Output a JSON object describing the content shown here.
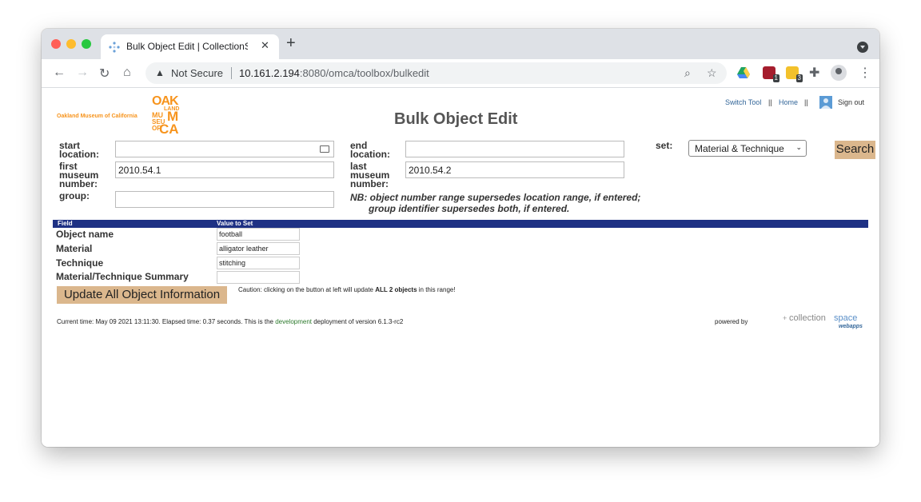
{
  "browser": {
    "tab_title": "Bulk Object Edit | CollectionSp",
    "security_label": "Not Secure",
    "url_host": "10.161.2.194",
    "url_rest": ":8080/omca/toolbox/bulkedit",
    "extension_badges": [
      "1",
      "3"
    ]
  },
  "header": {
    "org_name": "Oakland Museum of California",
    "logo_lines": [
      "OAK",
      "LAND",
      "MU",
      "M",
      "SEU",
      "OF",
      "CA"
    ],
    "page_title": "Bulk Object Edit",
    "nav": {
      "switch_tool": "Switch Tool",
      "separator": "||",
      "home": "Home",
      "sign_out": "Sign out"
    }
  },
  "form": {
    "start_location": {
      "label_1": "start",
      "label_2": "location:",
      "value": ""
    },
    "end_location": {
      "label_1": "end",
      "label_2": "location:",
      "value": ""
    },
    "set": {
      "label": "set:",
      "selected": "Material & Technique"
    },
    "search_label": "Search",
    "first_museum_number": {
      "label_1": "first",
      "label_2": "museum",
      "label_3": "number:",
      "value": "2010.54.1"
    },
    "last_museum_number": {
      "label_1": "last",
      "label_2": "museum",
      "label_3": "number:",
      "value": "2010.54.2"
    },
    "group": {
      "label": "group:",
      "value": ""
    },
    "note_line_1": "NB: object number range supersedes location range, if entered;",
    "note_line_2": "group identifier supersedes both, if entered."
  },
  "table": {
    "col_field": "Field",
    "col_value": "Value to Set",
    "rows": [
      {
        "field": "Object name",
        "value": "football"
      },
      {
        "field": "Material",
        "value": "alligator leather"
      },
      {
        "field": "Technique",
        "value": "stitching"
      },
      {
        "field": "Material/Technique Summary",
        "value": ""
      }
    ]
  },
  "update_button_label": "Update All Object Information",
  "caution": {
    "prefix": "Caution: clicking on the button at left will update ",
    "bold": "ALL 2 objects",
    "suffix": " in this range!"
  },
  "footer": {
    "status_prefix": "Current time: May 09 2021 13:11:30. Elapsed time: 0.37 seconds. This is the ",
    "deployment": "development",
    "status_suffix": " deployment of version 6.1.3-rc2",
    "powered_by": "powered by",
    "brand_collection": "collection",
    "brand_space": "space",
    "brand_webapps": "webapps"
  },
  "colors": {
    "accent_orange": "#f7941d",
    "header_bar": "#1e3184",
    "button_tan": "#dbb78d",
    "link_blue": "#336699",
    "dev_green": "#2d7a2d"
  }
}
